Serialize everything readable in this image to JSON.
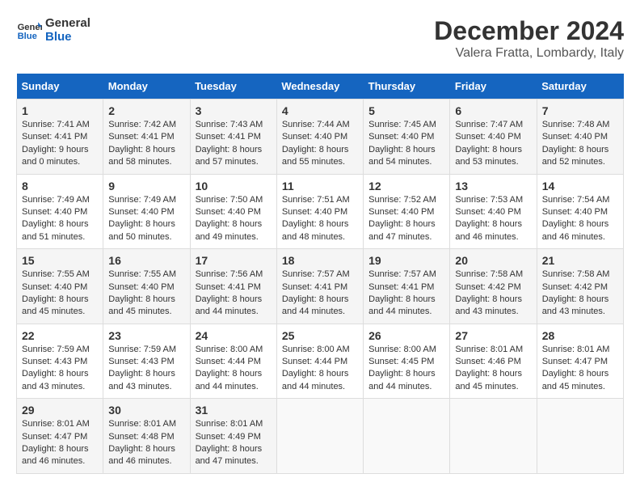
{
  "logo": {
    "line1": "General",
    "line2": "Blue"
  },
  "title": "December 2024",
  "location": "Valera Fratta, Lombardy, Italy",
  "days_of_week": [
    "Sunday",
    "Monday",
    "Tuesday",
    "Wednesday",
    "Thursday",
    "Friday",
    "Saturday"
  ],
  "weeks": [
    [
      {
        "day": "1",
        "info": "Sunrise: 7:41 AM\nSunset: 4:41 PM\nDaylight: 9 hours\nand 0 minutes."
      },
      {
        "day": "2",
        "info": "Sunrise: 7:42 AM\nSunset: 4:41 PM\nDaylight: 8 hours\nand 58 minutes."
      },
      {
        "day": "3",
        "info": "Sunrise: 7:43 AM\nSunset: 4:41 PM\nDaylight: 8 hours\nand 57 minutes."
      },
      {
        "day": "4",
        "info": "Sunrise: 7:44 AM\nSunset: 4:40 PM\nDaylight: 8 hours\nand 55 minutes."
      },
      {
        "day": "5",
        "info": "Sunrise: 7:45 AM\nSunset: 4:40 PM\nDaylight: 8 hours\nand 54 minutes."
      },
      {
        "day": "6",
        "info": "Sunrise: 7:47 AM\nSunset: 4:40 PM\nDaylight: 8 hours\nand 53 minutes."
      },
      {
        "day": "7",
        "info": "Sunrise: 7:48 AM\nSunset: 4:40 PM\nDaylight: 8 hours\nand 52 minutes."
      }
    ],
    [
      {
        "day": "8",
        "info": "Sunrise: 7:49 AM\nSunset: 4:40 PM\nDaylight: 8 hours\nand 51 minutes."
      },
      {
        "day": "9",
        "info": "Sunrise: 7:49 AM\nSunset: 4:40 PM\nDaylight: 8 hours\nand 50 minutes."
      },
      {
        "day": "10",
        "info": "Sunrise: 7:50 AM\nSunset: 4:40 PM\nDaylight: 8 hours\nand 49 minutes."
      },
      {
        "day": "11",
        "info": "Sunrise: 7:51 AM\nSunset: 4:40 PM\nDaylight: 8 hours\nand 48 minutes."
      },
      {
        "day": "12",
        "info": "Sunrise: 7:52 AM\nSunset: 4:40 PM\nDaylight: 8 hours\nand 47 minutes."
      },
      {
        "day": "13",
        "info": "Sunrise: 7:53 AM\nSunset: 4:40 PM\nDaylight: 8 hours\nand 46 minutes."
      },
      {
        "day": "14",
        "info": "Sunrise: 7:54 AM\nSunset: 4:40 PM\nDaylight: 8 hours\nand 46 minutes."
      }
    ],
    [
      {
        "day": "15",
        "info": "Sunrise: 7:55 AM\nSunset: 4:40 PM\nDaylight: 8 hours\nand 45 minutes."
      },
      {
        "day": "16",
        "info": "Sunrise: 7:55 AM\nSunset: 4:40 PM\nDaylight: 8 hours\nand 45 minutes."
      },
      {
        "day": "17",
        "info": "Sunrise: 7:56 AM\nSunset: 4:41 PM\nDaylight: 8 hours\nand 44 minutes."
      },
      {
        "day": "18",
        "info": "Sunrise: 7:57 AM\nSunset: 4:41 PM\nDaylight: 8 hours\nand 44 minutes."
      },
      {
        "day": "19",
        "info": "Sunrise: 7:57 AM\nSunset: 4:41 PM\nDaylight: 8 hours\nand 44 minutes."
      },
      {
        "day": "20",
        "info": "Sunrise: 7:58 AM\nSunset: 4:42 PM\nDaylight: 8 hours\nand 43 minutes."
      },
      {
        "day": "21",
        "info": "Sunrise: 7:58 AM\nSunset: 4:42 PM\nDaylight: 8 hours\nand 43 minutes."
      }
    ],
    [
      {
        "day": "22",
        "info": "Sunrise: 7:59 AM\nSunset: 4:43 PM\nDaylight: 8 hours\nand 43 minutes."
      },
      {
        "day": "23",
        "info": "Sunrise: 7:59 AM\nSunset: 4:43 PM\nDaylight: 8 hours\nand 43 minutes."
      },
      {
        "day": "24",
        "info": "Sunrise: 8:00 AM\nSunset: 4:44 PM\nDaylight: 8 hours\nand 44 minutes."
      },
      {
        "day": "25",
        "info": "Sunrise: 8:00 AM\nSunset: 4:44 PM\nDaylight: 8 hours\nand 44 minutes."
      },
      {
        "day": "26",
        "info": "Sunrise: 8:00 AM\nSunset: 4:45 PM\nDaylight: 8 hours\nand 44 minutes."
      },
      {
        "day": "27",
        "info": "Sunrise: 8:01 AM\nSunset: 4:46 PM\nDaylight: 8 hours\nand 45 minutes."
      },
      {
        "day": "28",
        "info": "Sunrise: 8:01 AM\nSunset: 4:47 PM\nDaylight: 8 hours\nand 45 minutes."
      }
    ],
    [
      {
        "day": "29",
        "info": "Sunrise: 8:01 AM\nSunset: 4:47 PM\nDaylight: 8 hours\nand 46 minutes."
      },
      {
        "day": "30",
        "info": "Sunrise: 8:01 AM\nSunset: 4:48 PM\nDaylight: 8 hours\nand 46 minutes."
      },
      {
        "day": "31",
        "info": "Sunrise: 8:01 AM\nSunset: 4:49 PM\nDaylight: 8 hours\nand 47 minutes."
      },
      {
        "day": "",
        "info": ""
      },
      {
        "day": "",
        "info": ""
      },
      {
        "day": "",
        "info": ""
      },
      {
        "day": "",
        "info": ""
      }
    ]
  ]
}
